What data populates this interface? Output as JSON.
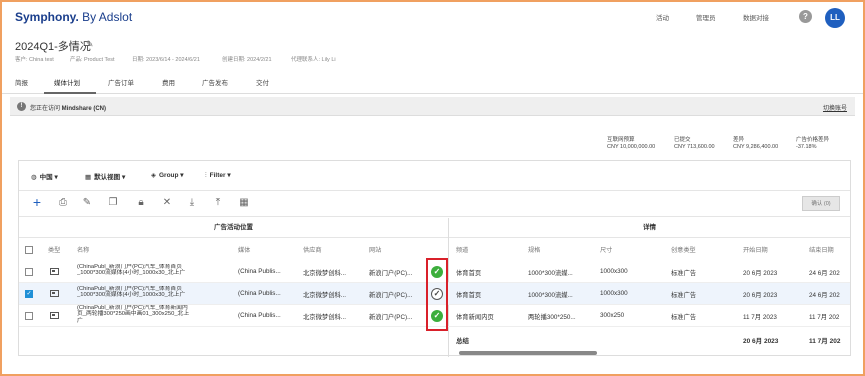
{
  "app": {
    "logo_brand": "Symphony.",
    "logo_suffix": " By Adslot",
    "nav": [
      "活动",
      "管理员",
      "数据对接"
    ],
    "help_label": "?",
    "avatar_initials": "LL"
  },
  "campaign": {
    "title": "2024Q1-多情况",
    "meta": {
      "customer": "客户: China test",
      "product": "产品: Product Test",
      "dates": "日期: 2023/6/14 - 2024/6/21",
      "created": "创建日期: 2024/2/21",
      "agency_contact": "代理联系人: Lily Li"
    }
  },
  "tabs": [
    "简报",
    "媒体计划",
    "广告订单",
    "费用",
    "广告发布",
    "交付"
  ],
  "banner": {
    "text_prefix": "您正在访问 ",
    "agency": "Mindshare (CN)",
    "switch_link": "切换账号"
  },
  "budget": [
    {
      "label": "互联网预算",
      "value": "CNY 10,000,000.00"
    },
    {
      "label": "已提交",
      "value": "CNY 713,600.00"
    },
    {
      "label": "差异",
      "value": "CNY 9,286,400.00"
    },
    {
      "label": "广告价格差异",
      "value": "-37.18%"
    }
  ],
  "filters": {
    "region": "中国",
    "view": "默认视图",
    "group": "Group",
    "filter": "Filter"
  },
  "toolbar": {
    "confirm_label": "确认 (0)"
  },
  "table": {
    "left_section_title": "广告活动位置",
    "right_section_title": "详情",
    "columns": [
      "类型",
      "名称",
      "媒体",
      "供应商",
      "网站",
      "频道",
      "规格",
      "尺寸",
      "创意类型",
      "开始日期",
      "结束日期"
    ],
    "rows": [
      {
        "name_line1": "(ChinaPubl_新浪门户(PC)汽车_体育首页",
        "name_line2": "_1000*300流媒体(4小时_1000x30_北上广",
        "name_line3": "",
        "media": "(China Publis...",
        "vendor": "北京微梦创科...",
        "site": "新浪门户(PC)...",
        "status": "ok",
        "status_glyph": "✓",
        "channel": "体育首页",
        "spec": "1000*300流媒...",
        "size": "1000x300",
        "creative": "标准广告",
        "start": "20 6月 2023",
        "end": "24 6月 202",
        "checked": false
      },
      {
        "name_line1": "(ChinaPubl_新浪门户(PC)汽车_体育首页",
        "name_line2": "_1000*300流媒体(4小时_1000x30_北上广",
        "name_line3": "",
        "media": "(China Publis...",
        "vendor": "北京微梦创科...",
        "site": "新浪门户(PC)...",
        "status": "pending",
        "status_glyph": "✓",
        "channel": "体育首页",
        "spec": "1000*300流媒...",
        "size": "1000x300",
        "creative": "标准广告",
        "start": "20 6月 2023",
        "end": "24 6月 202",
        "checked": true
      },
      {
        "name_line1": "(ChinaPubl_新浪门户(PC)汽车_体育新闻内",
        "name_line2": "页_两轮播300*250画中画01_300x250_北上",
        "name_line3": "广",
        "media": "(China Publis...",
        "vendor": "北京微梦创科...",
        "site": "新浪门户(PC)...",
        "status": "ok",
        "status_glyph": "✓",
        "channel": "体育新闻内页",
        "spec": "两轮播300*250...",
        "size": "300x250",
        "creative": "标准广告",
        "start": "11 7月 2023",
        "end": "11 7月 202",
        "checked": false
      }
    ],
    "total_label": "总结",
    "total_start": "20 6月 2023",
    "total_end": "11 7月 202"
  },
  "colors": {
    "brand_blue": "#1a3e8c",
    "accent_blue": "#1f5fbf",
    "status_green": "#3cae3c",
    "highlight_red": "#d9202a",
    "frame_orange": "#f0a060"
  }
}
